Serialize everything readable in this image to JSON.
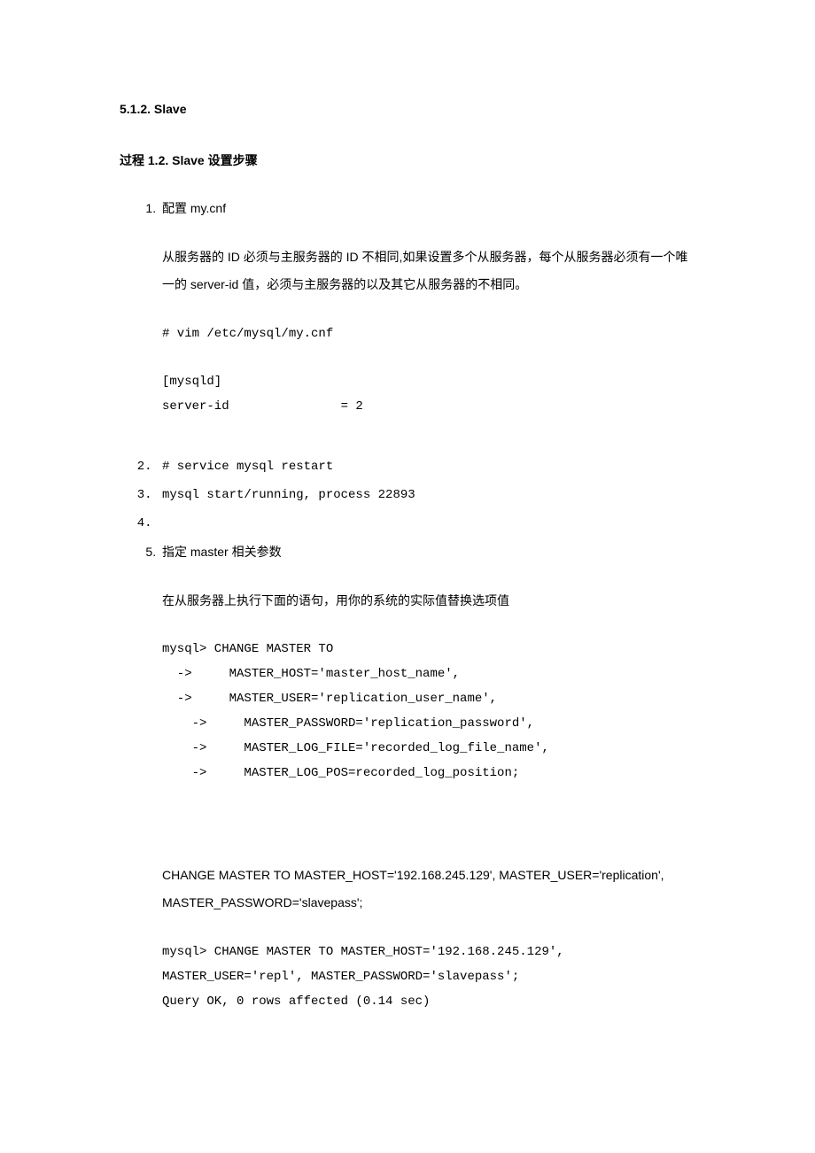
{
  "section_header": "5.1.2. Slave",
  "subheading": "过程 1.2. Slave 设置步骤",
  "step1": {
    "title": "配置 my.cnf",
    "desc": "从服务器的 ID 必须与主服务器的 ID 不相同,如果设置多个从服务器，每个从服务器必须有一个唯一的 server-id 值，必须与主服务器的以及其它从服务器的不相同。",
    "code1": "# vim /etc/mysql/my.cnf",
    "code2_l1": "[mysqld]",
    "code2_l2": "server-id               = 2"
  },
  "step2": "# service mysql restart",
  "step3": "mysql start/running, process 22893",
  "step4": "",
  "step5": {
    "title": "指定 master 相关参数",
    "desc": "在从服务器上执行下面的语句，用你的系统的实际值替换选项值",
    "codeA_l1": "mysql> CHANGE MASTER TO",
    "codeA_l2": "  ->     MASTER_HOST='master_host_name',",
    "codeA_l3": "  ->     MASTER_USER='replication_user_name',",
    "codeA_l4": "    ->     MASTER_PASSWORD='replication_password',",
    "codeA_l5": "    ->     MASTER_LOG_FILE='recorded_log_file_name',",
    "codeA_l6": "    ->     MASTER_LOG_POS=recorded_log_position;",
    "para2": "CHANGE MASTER TO MASTER_HOST='192.168.245.129', MASTER_USER='replication', MASTER_PASSWORD='slavepass';",
    "codeB_l1": "mysql> CHANGE MASTER TO MASTER_HOST='192.168.245.129', ",
    "codeB_l2": "MASTER_USER='repl', MASTER_PASSWORD='slavepass';",
    "codeB_l3": "Query OK, 0 rows affected (0.14 sec)"
  }
}
